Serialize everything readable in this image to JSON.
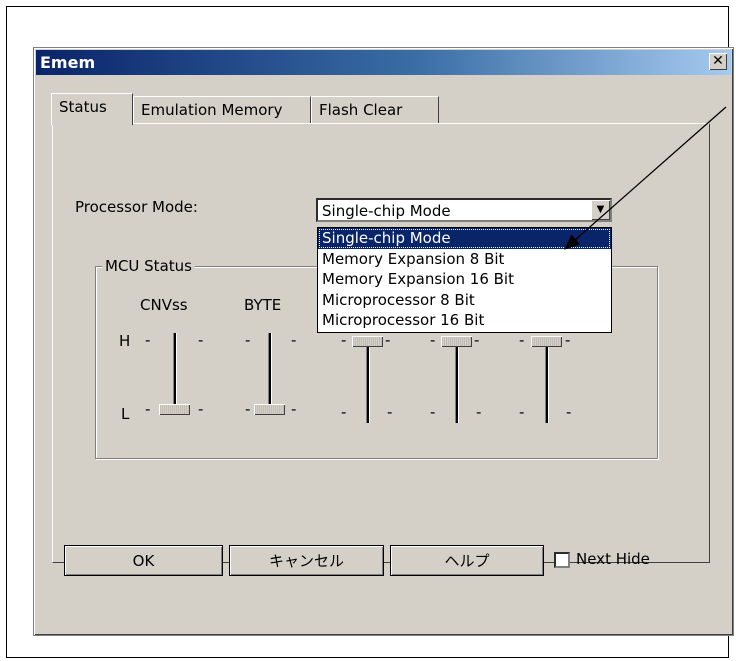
{
  "window": {
    "title": "Emem",
    "close_glyph": "✕"
  },
  "tabs": [
    "Status",
    "Emulation Memory",
    "Flash Clear"
  ],
  "processor_mode": {
    "label": "Processor Mode:",
    "selected": "Single-chip Mode",
    "options": [
      "Single-chip Mode",
      "Memory Expansion 8 Bit",
      "Memory Expansion 16 Bit",
      "Microprocessor 8 Bit",
      "Microprocessor 16 Bit"
    ]
  },
  "mcu_status": {
    "title": "MCU Status",
    "sliders": [
      {
        "name": "CNVss",
        "level": "L"
      },
      {
        "name": "BYTE",
        "level": "L"
      },
      {
        "name": "",
        "level": "H"
      },
      {
        "name": "",
        "level": "H"
      },
      {
        "name": "",
        "level": "H"
      }
    ],
    "high_label": "H",
    "low_label": "L",
    "tick_mark": "-"
  },
  "buttons": {
    "ok": "OK",
    "cancel": "キャンセル",
    "help": "ヘルプ"
  },
  "next_hide": {
    "label": "Next Hide",
    "checked": false
  }
}
